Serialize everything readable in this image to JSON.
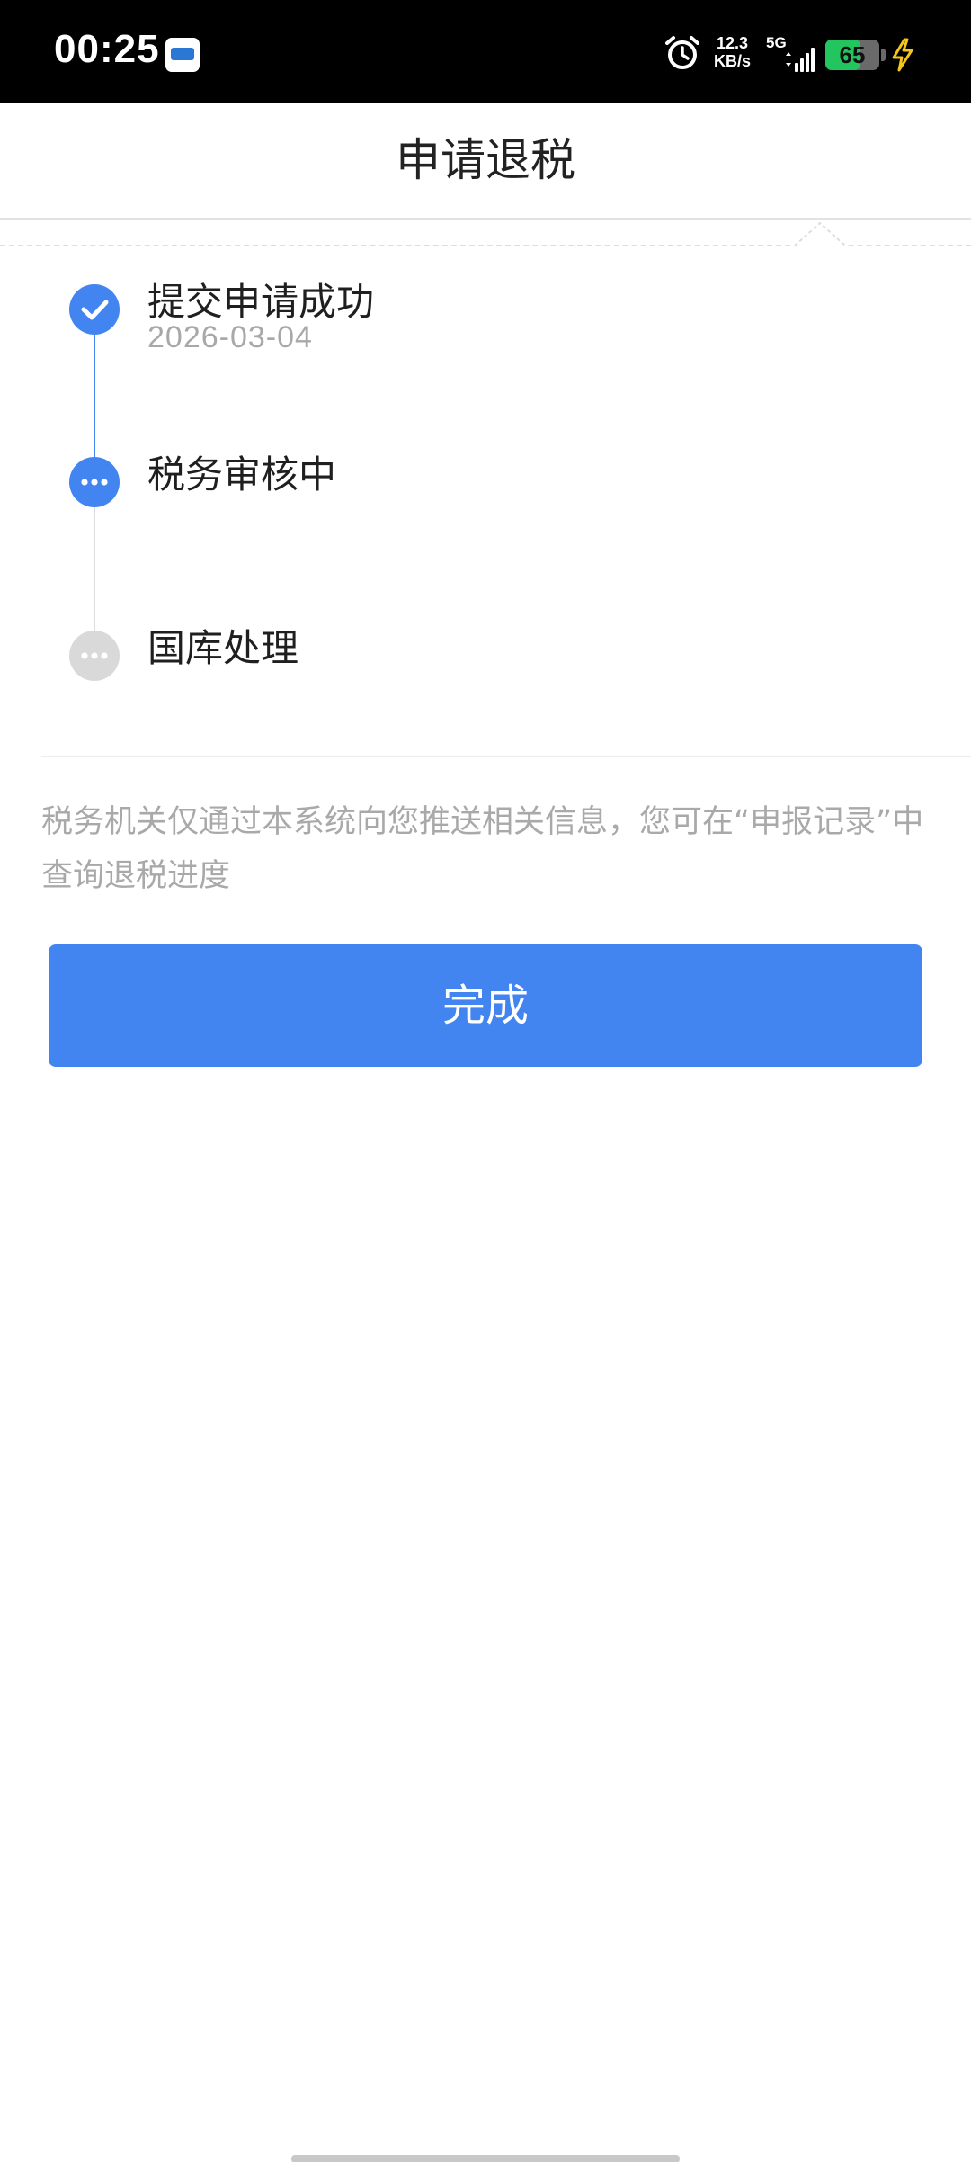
{
  "status_bar": {
    "time": "00:25",
    "net_speed_value": "12.3",
    "net_speed_unit": "KB/s",
    "network_type": "5G",
    "battery_level": "65",
    "battery_fraction": 0.65,
    "icons": [
      "app-notification-icon",
      "alarm-icon",
      "signal-icon",
      "battery-icon",
      "charging-icon"
    ]
  },
  "header": {
    "title": "申请退税"
  },
  "timeline": {
    "steps": [
      {
        "label": "提交申请成功",
        "date": "2026-03-04",
        "status": "completed"
      },
      {
        "label": "税务审核中",
        "date": "",
        "status": "in-progress"
      },
      {
        "label": "国库处理",
        "date": "",
        "status": "pending"
      }
    ]
  },
  "notice": {
    "text": "税务机关仅通过本系统向您推送相关信息，您可在“申报记录”中查询退税进度"
  },
  "actions": {
    "done_label": "完成"
  },
  "colors": {
    "accent": "#4285f0",
    "pending": "#d9d9d9",
    "muted_text": "#a9a9a9",
    "battery": "#22c55e"
  }
}
